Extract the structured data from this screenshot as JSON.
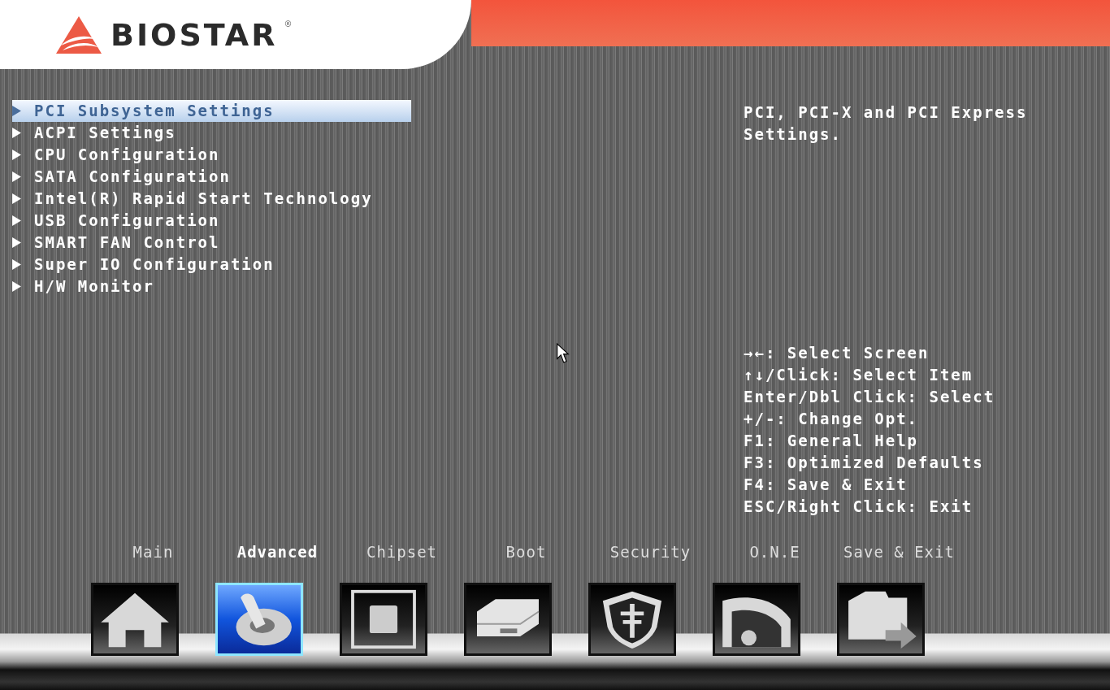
{
  "logo": {
    "text": "BIOSTAR",
    "mark": "®"
  },
  "menu": [
    {
      "label": "PCI Subsystem Settings",
      "selected": true
    },
    {
      "label": "ACPI Settings",
      "selected": false
    },
    {
      "label": "CPU Configuration",
      "selected": false
    },
    {
      "label": "SATA Configuration",
      "selected": false
    },
    {
      "label": "Intel(R) Rapid Start Technology",
      "selected": false
    },
    {
      "label": "USB Configuration",
      "selected": false
    },
    {
      "label": "SMART FAN Control",
      "selected": false
    },
    {
      "label": "Super IO Configuration",
      "selected": false
    },
    {
      "label": "H/W Monitor",
      "selected": false
    }
  ],
  "help": {
    "description": "PCI, PCI-X and PCI Express Settings.",
    "keys": [
      "→←: Select Screen",
      "↑↓/Click: Select Item",
      "Enter/Dbl Click: Select",
      "+/-: Change Opt.",
      "F1: General Help",
      "F3: Optimized Defaults",
      "F4: Save & Exit",
      "ESC/Right Click: Exit"
    ]
  },
  "tabs": [
    {
      "label": "Main",
      "kind": "home",
      "selected": false
    },
    {
      "label": "Advanced",
      "kind": "toggle",
      "selected": true
    },
    {
      "label": "Chipset",
      "kind": "chip",
      "selected": false
    },
    {
      "label": "Boot",
      "kind": "drive",
      "selected": false
    },
    {
      "label": "Security",
      "kind": "shield",
      "selected": false
    },
    {
      "label": "O.N.E",
      "kind": "gauge",
      "selected": false
    },
    {
      "label": "Save & Exit",
      "kind": "folder",
      "selected": false
    }
  ]
}
